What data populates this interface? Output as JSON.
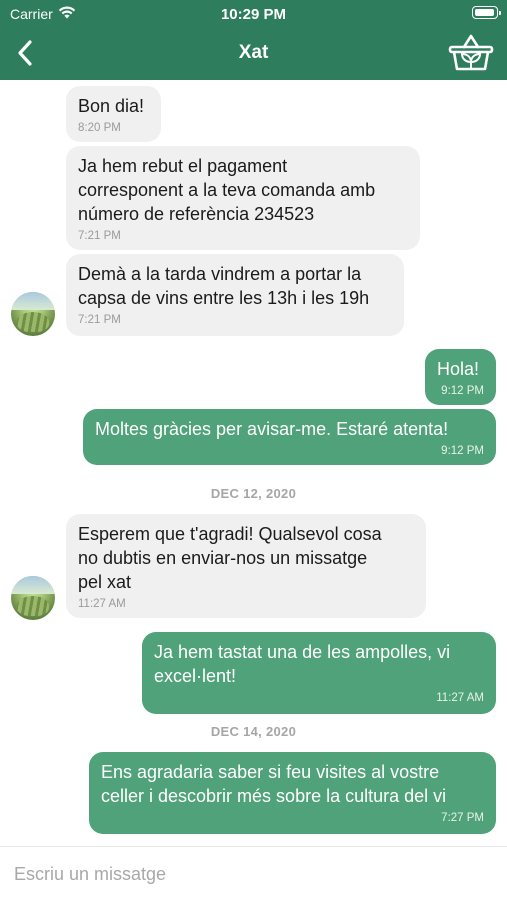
{
  "status": {
    "carrier": "Carrier",
    "time": "10:29 PM",
    "battery_level": 1.0
  },
  "nav": {
    "title": "Xat",
    "back_icon": "chevron-left-icon",
    "cart_icon": "shopping-basket-icon"
  },
  "messages": [
    {
      "dir": "in",
      "text": "Bon dia!",
      "time": "8:20 PM"
    },
    {
      "dir": "in",
      "text": "Ja hem rebut el pagament\ncorresponent a la teva comanda amb\nnúmero de referència 234523",
      "time": "7:21 PM"
    },
    {
      "dir": "in",
      "text": "Demà a la tarda vindrem a portar la\ncapsa de vins entre les 13h i les 19h",
      "time": "7:21 PM"
    },
    {
      "dir": "out",
      "text": "Hola!",
      "time": "9:12 PM"
    },
    {
      "dir": "out",
      "text": "Moltes gràcies per avisar-me. Estaré atenta!",
      "time": "9:12 PM"
    },
    {
      "dir": "in",
      "text": "Esperem que t'agradi! Qualsevol cosa\nno dubtis en enviar-nos un missatge\npel xat",
      "time": "11:27 AM"
    },
    {
      "dir": "out",
      "text": "Ja hem tastat una de les ampolles, vi\nexcel·lent!",
      "time": "11:27 AM"
    },
    {
      "dir": "out",
      "text": "Ens agradaria saber si feu visites al vostre\nceller i descobrir més sobre la cultura del vi",
      "time": "7:27 PM"
    }
  ],
  "date_separators": [
    "DEC 12, 2020",
    "DEC 14, 2020"
  ],
  "input": {
    "placeholder": "Escriu un missatge"
  },
  "colors": {
    "header": "#2e7d5c",
    "outgoing_bubble": "#4fa27a",
    "incoming_bubble": "#f0f0f0"
  }
}
